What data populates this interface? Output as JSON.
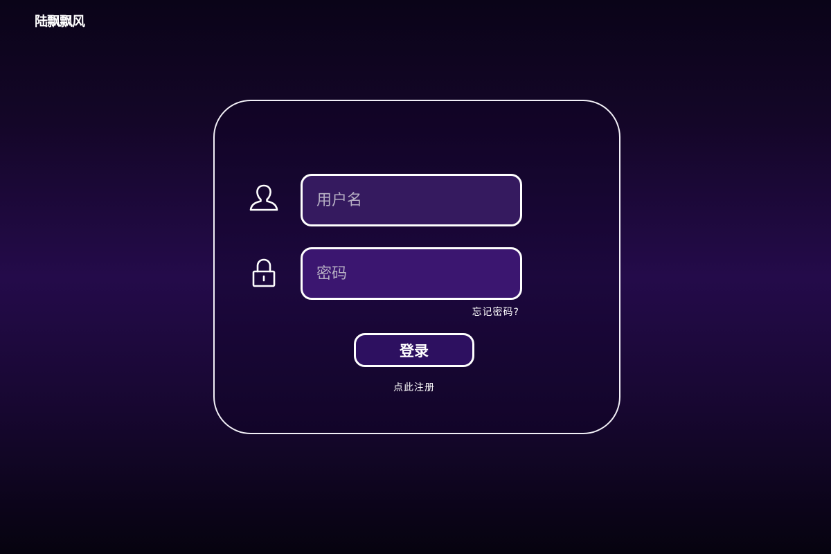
{
  "brand": {
    "logo_text": "陆飘飘风"
  },
  "login_form": {
    "username": {
      "icon": "user-icon",
      "placeholder": "用户名",
      "value": ""
    },
    "password": {
      "icon": "lock-icon",
      "placeholder": "密码",
      "value": ""
    },
    "forgot_password_label": "忘记密码?",
    "login_button_label": "登录",
    "register_link_label": "点此注册"
  },
  "theme": {
    "background_top": "#0a0418",
    "background_mid": "#240b4a",
    "username_field_fill": "#351a5f",
    "password_field_fill": "#3b1670",
    "button_fill": "#2d1060",
    "border": "#ffffff"
  }
}
